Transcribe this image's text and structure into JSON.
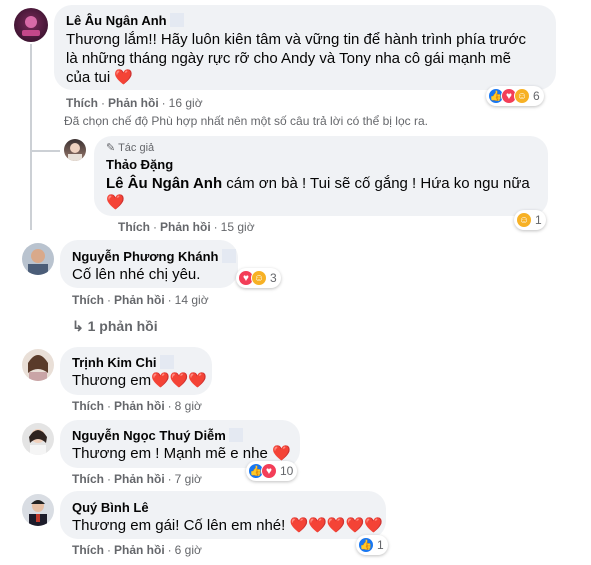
{
  "actions": {
    "like": "Thích",
    "reply": "Phản hồi",
    "sep": "·"
  },
  "comments": [
    {
      "name": "Lê Âu Ngân Anh",
      "lines": [
        "Thương lắm!! Hãy luôn kiên tâm và vững tin để hành trình phía trước",
        "là những tháng ngày rực rỡ cho Andy và Tony nha cô gái mạnh mẽ",
        "của tui"
      ],
      "heart": "❤️",
      "time": "16 giờ",
      "reactions": [
        "like",
        "love",
        "care"
      ],
      "reaction_count": "6"
    },
    {
      "name": "Nguyễn Phương Khánh",
      "text": "Cố lên nhé chị yêu.",
      "time": "14 giờ",
      "reactions": [
        "love",
        "care"
      ],
      "reaction_count": "3"
    },
    {
      "name": "Trịnh Kim Chi",
      "text": "Thương em",
      "hearts": "❤️❤️❤️",
      "time": "8 giờ"
    },
    {
      "name": "Nguyễn Ngọc Thuý Diễm",
      "text": "Thương em ! Mạnh mẽ e nhe",
      "heart": "❤️",
      "time": "7 giờ",
      "reactions": [
        "like",
        "love"
      ],
      "reaction_count": "10"
    },
    {
      "name": "Quý Bình Lê",
      "text": "Thương em gái! Cố lên em nhé!",
      "hearts": "❤️❤️❤️❤️❤️",
      "time": "6 giờ",
      "reactions": [
        "like"
      ],
      "reaction_count": "1"
    }
  ],
  "filter_notice": "Đã chọn chế độ Phù hợp nhất nên một số câu trả lời có thể bị lọc ra.",
  "reply": {
    "badge": "Tác giả",
    "name": "Thảo Đặng",
    "mention": "Lê Âu Ngân Anh",
    "text": " cám ơn bà ! Tui sẽ cố gắng ! Hứa ko ngu nữa",
    "heart": "❤️",
    "time": "15 giờ",
    "reactions": [
      "care"
    ],
    "reaction_count": "1"
  },
  "replies_link": "1 phản hồi",
  "colors": {
    "bubble": "#f0f2f5",
    "meta": "#65676b",
    "like": "#1877f2",
    "love": "#f33e58",
    "care": "#f7b125"
  }
}
